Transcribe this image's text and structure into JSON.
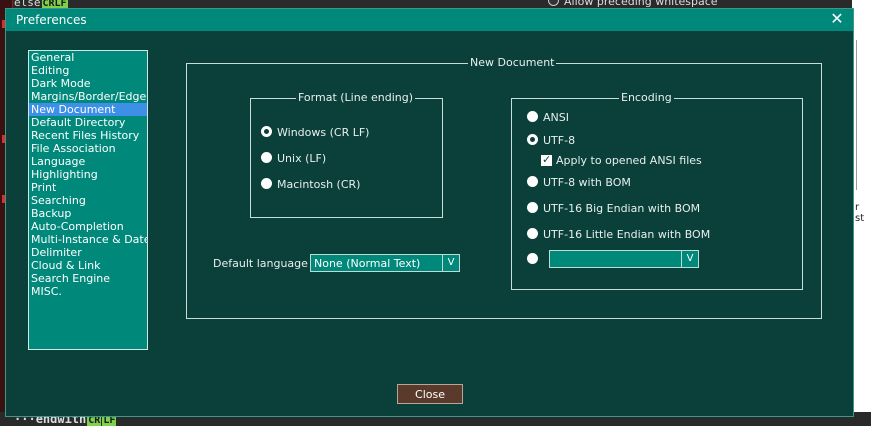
{
  "background": {
    "top_text": "Allow preceding whitespace",
    "left_top_text": "else",
    "left_top_badge": "CRLF",
    "bottom_text": "endwith",
    "bottom_badge_cr": "CR",
    "bottom_badge_lf": "LF",
    "bottom_dots": "···",
    "right_partial": "r st"
  },
  "dialog": {
    "title": "Preferences",
    "close_glyph": "✕",
    "close_button": "Close"
  },
  "categories": [
    {
      "label": "General"
    },
    {
      "label": "Editing"
    },
    {
      "label": "Dark Mode"
    },
    {
      "label": "Margins/Border/Edge"
    },
    {
      "label": "New Document",
      "selected": true
    },
    {
      "label": "Default Directory"
    },
    {
      "label": "Recent Files History"
    },
    {
      "label": "File Association"
    },
    {
      "label": "Language"
    },
    {
      "label": "Highlighting"
    },
    {
      "label": "Print"
    },
    {
      "label": "Searching"
    },
    {
      "label": "Backup"
    },
    {
      "label": "Auto-Completion"
    },
    {
      "label": "Multi-Instance & Date"
    },
    {
      "label": "Delimiter"
    },
    {
      "label": "Cloud & Link"
    },
    {
      "label": "Search Engine"
    },
    {
      "label": "MISC."
    }
  ],
  "new_document": {
    "title": "New Document",
    "format": {
      "title": "Format (Line ending)",
      "options": [
        "Windows (CR LF)",
        "Unix (LF)",
        "Macintosh (CR)"
      ],
      "selected": 0
    },
    "encoding": {
      "title": "Encoding",
      "ansi": "ANSI",
      "utf8": "UTF-8",
      "apply_ansi": "Apply to opened ANSI files",
      "apply_ansi_checked": true,
      "utf8_bom": "UTF-8 with BOM",
      "utf16_be": "UTF-16 Big Endian with BOM",
      "utf16_le": "UTF-16 Little Endian with BOM",
      "selected": "utf8",
      "other_dropdown_value": "",
      "dropdown_arrow": "V"
    },
    "default_language": {
      "label": "Default language :",
      "value": "None (Normal Text)",
      "dropdown_arrow": "V"
    }
  }
}
